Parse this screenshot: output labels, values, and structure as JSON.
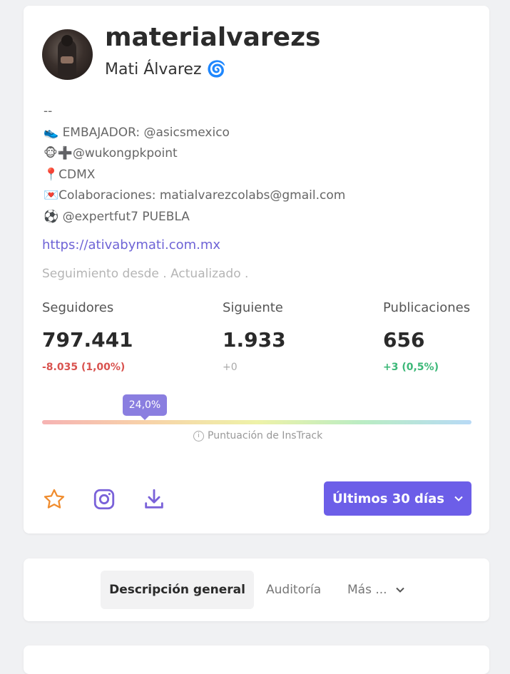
{
  "profile": {
    "username": "materialvarezs",
    "full_name": "Mati Álvarez",
    "full_name_emoji": "🌀",
    "bio_lines": [
      "--",
      "👟 EMBAJADOR: @asicsmexico",
      "🐵➕@wukongpkpoint",
      "📍CDMX",
      "💌Colaboraciones: matialvarezcolabs@gmail.com",
      "⚽ @expertfut7 PUEBLA"
    ],
    "website": "https://ativabymati.com.mx",
    "tracking_text": "Seguimiento desde . Actualizado ."
  },
  "stats": [
    {
      "label": "Seguidores",
      "value": "797.441",
      "delta": "-8.035 (1,00%)",
      "trend": "down"
    },
    {
      "label": "Siguiente",
      "value": "1.933",
      "delta": "+0",
      "trend": "flat"
    },
    {
      "label": "Publicaciones",
      "value": "656",
      "delta": "+3 (0,5%)",
      "trend": "up"
    }
  ],
  "score": {
    "value_label": "24,0%",
    "value": 24.0,
    "caption": "Puntuación de InsTrack"
  },
  "actions": {
    "favorite_icon": "star-icon",
    "instagram_icon": "instagram-icon",
    "download_icon": "download-icon",
    "range_label": "Últimos 30 días",
    "accent": "#6c5ee8"
  },
  "tabs": [
    {
      "label": "Descripción general",
      "active": true
    },
    {
      "label": "Auditoría",
      "active": false
    },
    {
      "label": "Más ...",
      "active": false
    }
  ]
}
